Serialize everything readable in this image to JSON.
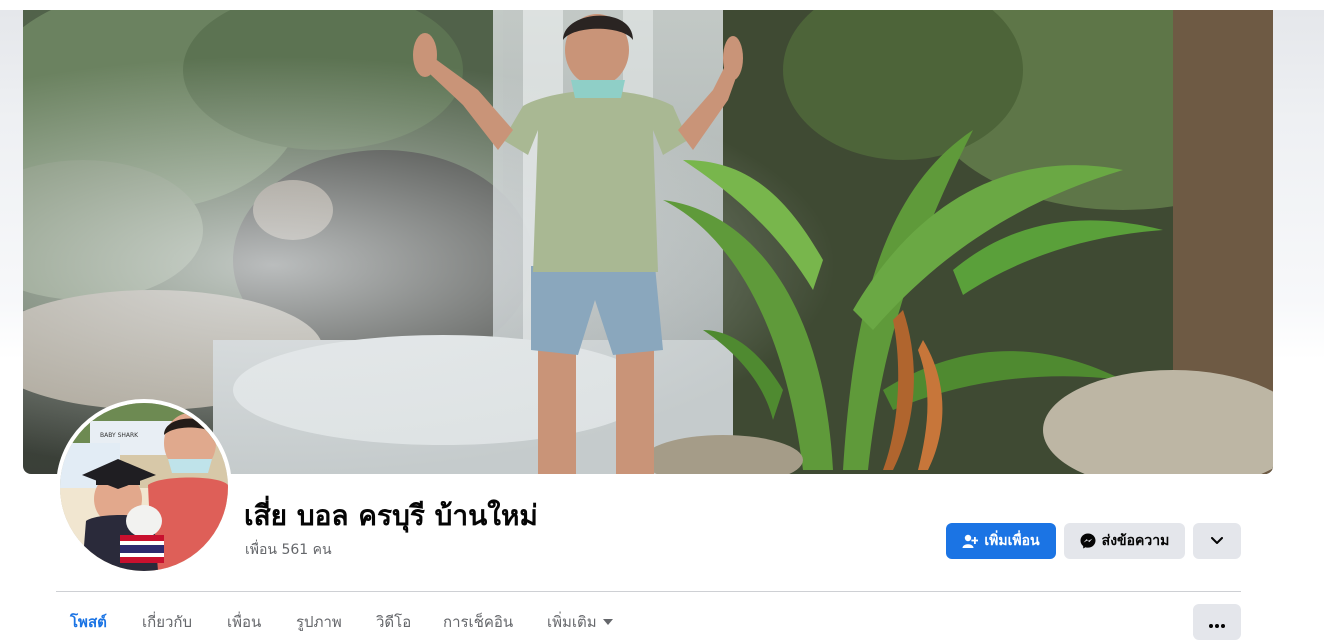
{
  "profile": {
    "name": "เสี่ย บอล ครบุรี บ้านใหม่",
    "friends_count": "เพื่อน 561 คน"
  },
  "actions": {
    "add_friend": "เพิ่มเพื่อน",
    "message": "ส่งข้อความ",
    "more_icon": "chevron-down-icon"
  },
  "avatar": {
    "sign_text": "BABY SHARK"
  },
  "tabs": [
    {
      "label": "โพสต์",
      "active": true
    },
    {
      "label": "เกี่ยวกับ"
    },
    {
      "label": "เพื่อน"
    },
    {
      "label": "รูปภาพ"
    },
    {
      "label": "วิดีโอ"
    },
    {
      "label": "การเช็คอิน"
    },
    {
      "label": "เพิ่มเติม"
    }
  ],
  "colors": {
    "accent": "#1b74e4",
    "secondary_button": "#e4e6eb",
    "muted_text": "#65676b"
  }
}
